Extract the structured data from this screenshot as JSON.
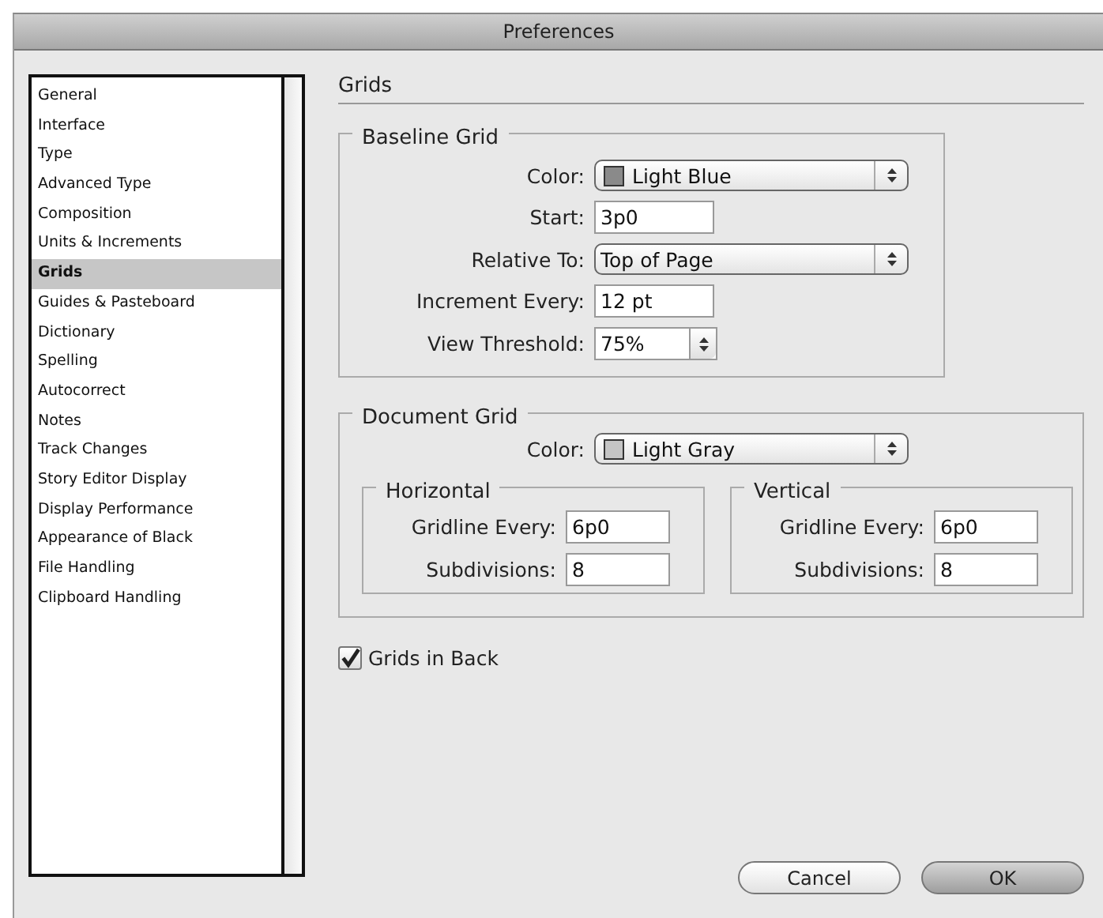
{
  "window": {
    "title": "Preferences"
  },
  "sidebar": {
    "items": [
      {
        "label": "General",
        "selected": false
      },
      {
        "label": "Interface",
        "selected": false
      },
      {
        "label": "Type",
        "selected": false
      },
      {
        "label": "Advanced Type",
        "selected": false
      },
      {
        "label": "Composition",
        "selected": false
      },
      {
        "label": "Units & Increments",
        "selected": false
      },
      {
        "label": "Grids",
        "selected": true
      },
      {
        "label": "Guides & Pasteboard",
        "selected": false
      },
      {
        "label": "Dictionary",
        "selected": false
      },
      {
        "label": "Spelling",
        "selected": false
      },
      {
        "label": "Autocorrect",
        "selected": false
      },
      {
        "label": "Notes",
        "selected": false
      },
      {
        "label": "Track Changes",
        "selected": false
      },
      {
        "label": "Story Editor Display",
        "selected": false
      },
      {
        "label": "Display Performance",
        "selected": false
      },
      {
        "label": "Appearance of Black",
        "selected": false
      },
      {
        "label": "File Handling",
        "selected": false
      },
      {
        "label": "Clipboard Handling",
        "selected": false
      }
    ]
  },
  "panel": {
    "title": "Grids"
  },
  "baseline_grid": {
    "title": "Baseline Grid",
    "fields": [
      {
        "kind": "select",
        "label": "Color:",
        "value": "Light Blue",
        "color": "#8a8a8a"
      },
      {
        "kind": "text",
        "label": "Start:",
        "value": "3p0"
      },
      {
        "kind": "select",
        "label": "Relative To:",
        "value": "Top of Page"
      },
      {
        "kind": "text",
        "label": "Increment Every:",
        "value": "12 pt"
      },
      {
        "kind": "combo",
        "label": "View Threshold:",
        "value": "75%"
      }
    ]
  },
  "document_grid": {
    "title": "Document Grid",
    "fields": [
      {
        "kind": "select",
        "label": "Color:",
        "value": "Light Gray",
        "color": "#c4c4c4"
      }
    ],
    "groups": [
      {
        "title": "Horizontal",
        "fields": [
          {
            "kind": "text",
            "label": "Gridline Every:",
            "value": "6p0"
          },
          {
            "kind": "text",
            "label": "Subdivisions:",
            "value": "8"
          }
        ]
      },
      {
        "title": "Vertical",
        "fields": [
          {
            "kind": "text",
            "label": "Gridline Every:",
            "value": "6p0"
          },
          {
            "kind": "text",
            "label": "Subdivisions:",
            "value": "8"
          }
        ]
      }
    ]
  },
  "grids_in_back": {
    "label": "Grids in Back",
    "checked": true
  },
  "buttons": [
    {
      "label": "Cancel",
      "kind": "normal"
    },
    {
      "label": "OK",
      "kind": "default"
    }
  ]
}
